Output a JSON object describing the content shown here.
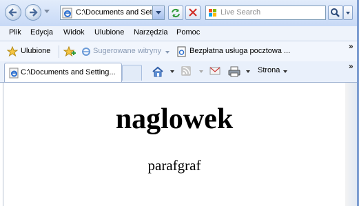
{
  "address": {
    "value": "C:\\Documents and Set"
  },
  "search": {
    "placeholder": "Live Search"
  },
  "menu": {
    "items": [
      {
        "label": "Plik"
      },
      {
        "label": "Edycja"
      },
      {
        "label": "Widok"
      },
      {
        "label": "Ulubione"
      },
      {
        "label": "Narzędzia"
      },
      {
        "label": "Pomoc"
      }
    ]
  },
  "favorites_bar": {
    "favorites_label": "Ulubione",
    "suggested_label": "Sugerowane witryny",
    "free_mail_label": "Bezpłatna usługa pocztowa ...",
    "overflow": "»"
  },
  "tab": {
    "title": "C:\\Documents and Setting..."
  },
  "command_bar": {
    "page_label": "Strona",
    "overflow": "»"
  },
  "page": {
    "heading": "naglowek",
    "paragraph": "parafgraf"
  }
}
